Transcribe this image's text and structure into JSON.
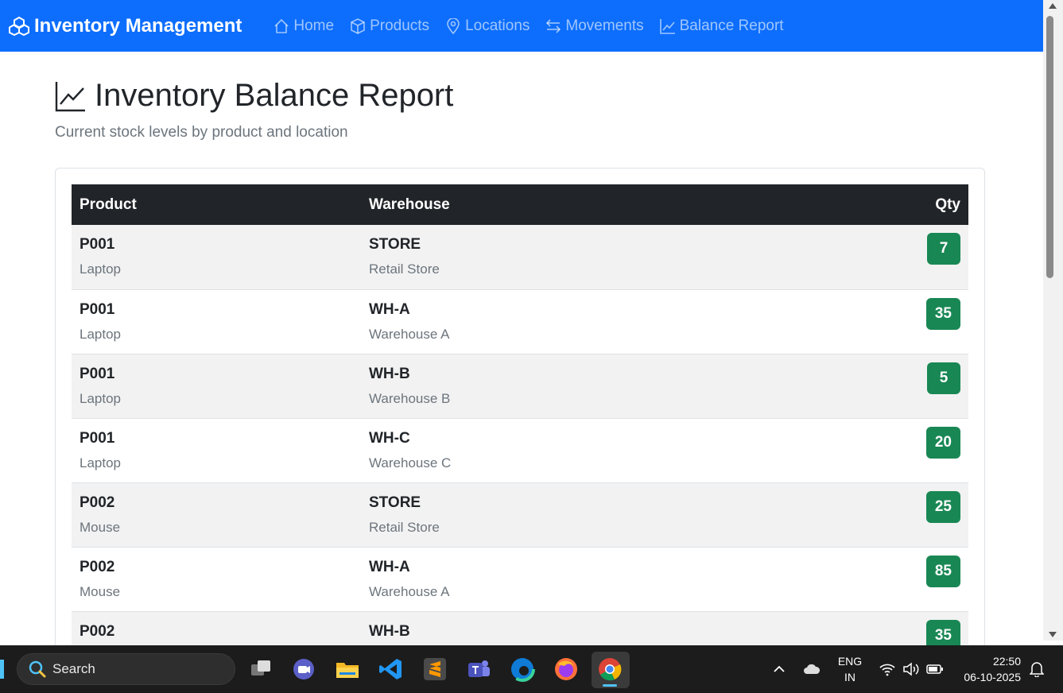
{
  "navbar": {
    "brand": "Inventory Management",
    "items": [
      {
        "label": "Home",
        "icon": "house-icon"
      },
      {
        "label": "Products",
        "icon": "box-icon"
      },
      {
        "label": "Locations",
        "icon": "geo-pin-icon"
      },
      {
        "label": "Movements",
        "icon": "arrow-left-right-icon"
      },
      {
        "label": "Balance Report",
        "icon": "graph-up-icon"
      }
    ]
  },
  "page": {
    "title": "Inventory Balance Report",
    "subtitle": "Current stock levels by product and location"
  },
  "table": {
    "headers": {
      "product": "Product",
      "warehouse": "Warehouse",
      "qty": "Qty"
    },
    "rows": [
      {
        "product_code": "P001",
        "product_name": "Laptop",
        "warehouse_code": "STORE",
        "warehouse_name": "Retail Store",
        "qty": "7"
      },
      {
        "product_code": "P001",
        "product_name": "Laptop",
        "warehouse_code": "WH-A",
        "warehouse_name": "Warehouse A",
        "qty": "35"
      },
      {
        "product_code": "P001",
        "product_name": "Laptop",
        "warehouse_code": "WH-B",
        "warehouse_name": "Warehouse B",
        "qty": "5"
      },
      {
        "product_code": "P001",
        "product_name": "Laptop",
        "warehouse_code": "WH-C",
        "warehouse_name": "Warehouse C",
        "qty": "20"
      },
      {
        "product_code": "P002",
        "product_name": "Mouse",
        "warehouse_code": "STORE",
        "warehouse_name": "Retail Store",
        "qty": "25"
      },
      {
        "product_code": "P002",
        "product_name": "Mouse",
        "warehouse_code": "WH-A",
        "warehouse_name": "Warehouse A",
        "qty": "85"
      },
      {
        "product_code": "P002",
        "product_name": "",
        "warehouse_code": "WH-B",
        "warehouse_name": "",
        "qty": "35"
      }
    ]
  },
  "taskbar": {
    "search_placeholder": "Search",
    "lang_line1": "ENG",
    "lang_line2": "IN",
    "time": "22:50",
    "date": "06-10-2025"
  },
  "colors": {
    "navbar": "#0d6efd",
    "table_header": "#212529",
    "badge": "#198754",
    "stripe": "#f2f2f2"
  }
}
